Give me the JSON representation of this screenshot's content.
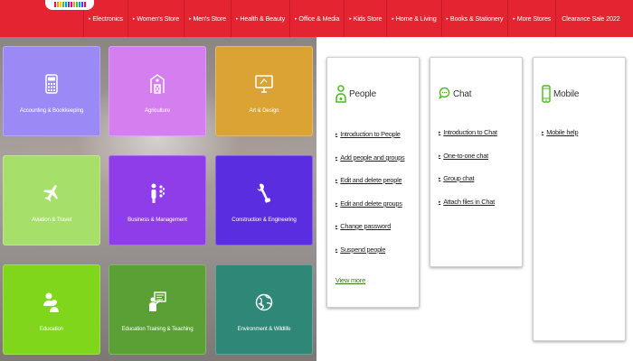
{
  "nav": {
    "items": [
      {
        "label": "Electronics"
      },
      {
        "label": "Women's Store"
      },
      {
        "label": "Men's Store"
      },
      {
        "label": "Health & Beauty"
      },
      {
        "label": "Office & Media"
      },
      {
        "label": "Kids Store"
      },
      {
        "label": "Home & Living"
      },
      {
        "label": "Books & Stationery"
      },
      {
        "label": "More Stores"
      }
    ],
    "sale_label": "Clearance Sale 2022"
  },
  "categories": [
    {
      "label": "Accounting & Bookkeeping",
      "icon": "calculator-icon",
      "color": "#9b8af5"
    },
    {
      "label": "Agriculture",
      "icon": "barn-icon",
      "color": "#d57ef0"
    },
    {
      "label": "Art & Design",
      "icon": "monitor-icon",
      "color": "#dba234"
    },
    {
      "label": "Aviation & Travel",
      "icon": "airplane-icon",
      "color": "#a6e06a"
    },
    {
      "label": "Business & Management",
      "icon": "business-icon",
      "color": "#8f3de8"
    },
    {
      "label": "Construction & Engineering",
      "icon": "tools-icon",
      "color": "#5a2ee0"
    },
    {
      "label": "Education",
      "icon": "people-icon",
      "color": "#7fd61a"
    },
    {
      "label": "Education Training & Teaching",
      "icon": "teacher-icon",
      "color": "#5aa034"
    },
    {
      "label": "Environment & Wildlife",
      "icon": "globe-icon",
      "color": "#2f8777"
    }
  ],
  "cards": {
    "people": {
      "title": "People",
      "icon": "people-icon",
      "links": [
        "Introduction to People",
        "Add people and groups",
        "Edit and delete people",
        "Edit and delete groups",
        "Change password",
        "Suspend people"
      ],
      "view_more": "View more"
    },
    "chat": {
      "title": "Chat",
      "icon": "chat-bubble-icon",
      "links": [
        "Introduction to Chat",
        "One-to-one chat",
        "Group chat",
        "Attach files in Chat"
      ]
    },
    "mobile": {
      "title": "Mobile",
      "icon": "mobile-phone-icon",
      "links": [
        "Mobile help"
      ]
    }
  },
  "colors": {
    "brand_red": "#e52432",
    "icon_green": "#4cbb1a"
  }
}
